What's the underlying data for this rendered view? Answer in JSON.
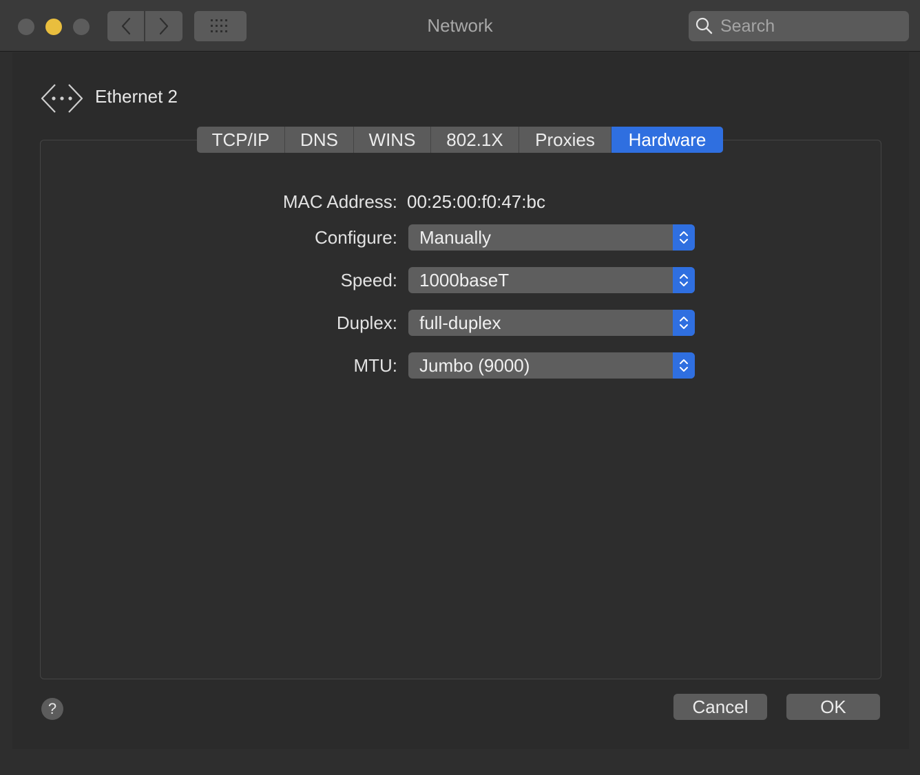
{
  "window": {
    "title": "Network",
    "search_placeholder": "Search"
  },
  "interface": {
    "name": "Ethernet 2"
  },
  "tabs": [
    {
      "label": "TCP/IP",
      "active": false
    },
    {
      "label": "DNS",
      "active": false
    },
    {
      "label": "WINS",
      "active": false
    },
    {
      "label": "802.1X",
      "active": false
    },
    {
      "label": "Proxies",
      "active": false
    },
    {
      "label": "Hardware",
      "active": true
    }
  ],
  "hardware": {
    "mac_label": "MAC Address:",
    "mac_value": "00:25:00:f0:47:bc",
    "configure_label": "Configure:",
    "configure_value": "Manually",
    "speed_label": "Speed:",
    "speed_value": "1000baseT",
    "duplex_label": "Duplex:",
    "duplex_value": "full-duplex",
    "mtu_label": "MTU:",
    "mtu_value": "Jumbo (9000)"
  },
  "footer": {
    "help": "?",
    "cancel_label": "Cancel",
    "ok_label": "OK"
  },
  "colors": {
    "accent": "#2f6fe0",
    "minimize": "#e9be3e",
    "window_bg": "#2b2b2b",
    "titlebar_bg": "#3a3a3a"
  }
}
